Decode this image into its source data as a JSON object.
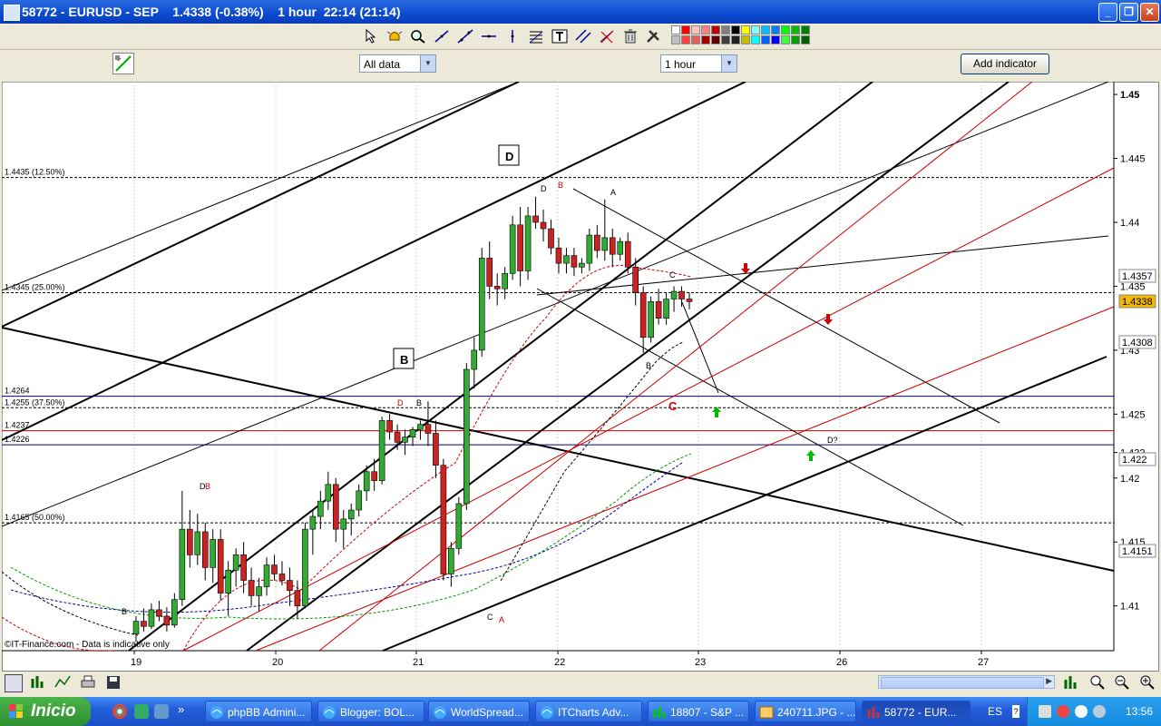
{
  "window": {
    "title": "58772 - EURUSD - SEP    1.4338 (-0.38%)    1 hour  22:14 (21:14)",
    "min": "_",
    "max": "❐",
    "close": "✕"
  },
  "toolbar": {
    "tools": [
      "cursor-icon",
      "alarm-icon",
      "zoom-icon",
      "line-icon",
      "trendline-icon",
      "horizontal-line-icon",
      "vertical-line-icon",
      "fibonacci-icon",
      "text-icon",
      "parallel-lines-icon",
      "delete-line-icon",
      "trash-icon",
      "tools-icon"
    ],
    "palette": [
      "#ffffff",
      "#ff0000",
      "#ffc0c0",
      "#ff8080",
      "#c00000",
      "#808080",
      "#000000",
      "#ffff00",
      "#80ffff",
      "#00c0ff",
      "#0080ff",
      "#00ff00",
      "#00c000",
      "#008000",
      "#c0c0c0",
      "#ff4040",
      "#e06060",
      "#a00000",
      "#600000",
      "#404040",
      "#202020",
      "#c0c000",
      "#00ffff",
      "#0060ff",
      "#0000ff",
      "#40ff40",
      "#00a000",
      "#006000"
    ]
  },
  "controls": {
    "range_select": "All data",
    "interval_select": "1 hour",
    "add_indicator": "Add indicator"
  },
  "chart_data": {
    "type": "candlestick",
    "symbol": "EURUSD",
    "interval": "1 hour",
    "ylim": [
      1.4065,
      1.451
    ],
    "y_ticks": [
      "1.45",
      "1.445",
      "1.44",
      "1.435",
      "1.43",
      "1.425",
      "1.422",
      "1.42",
      "1.415",
      "1.41"
    ],
    "x_ticks": [
      "19",
      "20",
      "21",
      "22",
      "23",
      "26",
      "27"
    ],
    "watermark": "©IT-Finance.com - Data is indicative only",
    "price_tags": [
      {
        "value": "1.4357",
        "color": "#cc2020",
        "bg": "#ffffff"
      },
      {
        "value": "1.4338",
        "color": "#000000",
        "bg": "#f5b800"
      },
      {
        "value": "1.4308",
        "color": "#000000",
        "bg": "#ffffff"
      },
      {
        "value": "1.422",
        "color": "#000000",
        "bg": "#ffffff"
      },
      {
        "value": "1.4151",
        "color": "#008000",
        "bg": "#ffffff"
      }
    ],
    "horizontal_lines": [
      {
        "label": "1.4435 (12.50%)",
        "value": 1.4435,
        "style": "dashed",
        "color": "#000000"
      },
      {
        "label": "1.4345 (25.00%)",
        "value": 1.4345,
        "style": "dashed",
        "color": "#000000"
      },
      {
        "label": "1.4264",
        "value": 1.4264,
        "style": "solid",
        "color": "#000080"
      },
      {
        "label": "1.4255 (37.50%)",
        "value": 1.4255,
        "style": "dashed",
        "color": "#000000"
      },
      {
        "label": "1.4237",
        "value": 1.4237,
        "style": "solid",
        "color": "#cc0000"
      },
      {
        "label": "1.4226",
        "value": 1.4226,
        "style": "solid",
        "color": "#000080"
      },
      {
        "label": "1.4165 (50.00%)",
        "value": 1.4165,
        "style": "dashed",
        "color": "#000000"
      }
    ],
    "wave_labels": [
      {
        "text": "D",
        "boxed": true
      },
      {
        "text": "B",
        "boxed": true
      },
      {
        "text": "D",
        "color": "#000000"
      },
      {
        "text": "B",
        "color": "#cc0000"
      },
      {
        "text": "A",
        "color": "#000000"
      },
      {
        "text": "C",
        "color": "#000000"
      },
      {
        "text": "B",
        "color": "#000000"
      },
      {
        "text": "C",
        "color": "#cc0000"
      },
      {
        "text": "D?",
        "color": "#000000"
      },
      {
        "text": "D",
        "color": "#cc0000"
      },
      {
        "text": "B",
        "color": "#000000"
      },
      {
        "text": "D",
        "color": "#000000"
      },
      {
        "text": "B",
        "color": "#cc0000"
      },
      {
        "text": "B",
        "color": "#000000"
      },
      {
        "text": "C",
        "color": "#000000"
      },
      {
        "text": "A",
        "color": "#cc0000"
      }
    ],
    "candles": [
      {
        "o": 1.4078,
        "h": 1.4092,
        "l": 1.4072,
        "c": 1.4088
      },
      {
        "o": 1.4088,
        "h": 1.4098,
        "l": 1.408,
        "c": 1.4084
      },
      {
        "o": 1.4084,
        "h": 1.4102,
        "l": 1.4082,
        "c": 1.4097
      },
      {
        "o": 1.4097,
        "h": 1.4104,
        "l": 1.4088,
        "c": 1.4092
      },
      {
        "o": 1.4092,
        "h": 1.4099,
        "l": 1.408,
        "c": 1.4085
      },
      {
        "o": 1.4085,
        "h": 1.411,
        "l": 1.4083,
        "c": 1.4105
      },
      {
        "o": 1.4105,
        "h": 1.419,
        "l": 1.41,
        "c": 1.416
      },
      {
        "o": 1.416,
        "h": 1.4175,
        "l": 1.413,
        "c": 1.414
      },
      {
        "o": 1.414,
        "h": 1.4172,
        "l": 1.4132,
        "c": 1.4158
      },
      {
        "o": 1.4158,
        "h": 1.4165,
        "l": 1.412,
        "c": 1.413
      },
      {
        "o": 1.413,
        "h": 1.416,
        "l": 1.4118,
        "c": 1.4152
      },
      {
        "o": 1.4152,
        "h": 1.416,
        "l": 1.4104,
        "c": 1.411
      },
      {
        "o": 1.411,
        "h": 1.4135,
        "l": 1.4092,
        "c": 1.4128
      },
      {
        "o": 1.4128,
        "h": 1.4145,
        "l": 1.4115,
        "c": 1.414
      },
      {
        "o": 1.414,
        "h": 1.415,
        "l": 1.411,
        "c": 1.412
      },
      {
        "o": 1.412,
        "h": 1.413,
        "l": 1.41,
        "c": 1.4108
      },
      {
        "o": 1.4108,
        "h": 1.4122,
        "l": 1.4096,
        "c": 1.4115
      },
      {
        "o": 1.4115,
        "h": 1.4138,
        "l": 1.4108,
        "c": 1.4132
      },
      {
        "o": 1.4132,
        "h": 1.414,
        "l": 1.412,
        "c": 1.4125
      },
      {
        "o": 1.4125,
        "h": 1.4135,
        "l": 1.4116,
        "c": 1.412
      },
      {
        "o": 1.412,
        "h": 1.413,
        "l": 1.41,
        "c": 1.4112
      },
      {
        "o": 1.4112,
        "h": 1.412,
        "l": 1.409,
        "c": 1.41
      },
      {
        "o": 1.41,
        "h": 1.4165,
        "l": 1.4098,
        "c": 1.416
      },
      {
        "o": 1.416,
        "h": 1.4175,
        "l": 1.414,
        "c": 1.417
      },
      {
        "o": 1.417,
        "h": 1.419,
        "l": 1.416,
        "c": 1.4182
      },
      {
        "o": 1.4182,
        "h": 1.4205,
        "l": 1.4175,
        "c": 1.4195
      },
      {
        "o": 1.4195,
        "h": 1.42,
        "l": 1.415,
        "c": 1.416
      },
      {
        "o": 1.416,
        "h": 1.4175,
        "l": 1.4145,
        "c": 1.4168
      },
      {
        "o": 1.4168,
        "h": 1.418,
        "l": 1.4155,
        "c": 1.4175
      },
      {
        "o": 1.4175,
        "h": 1.4195,
        "l": 1.417,
        "c": 1.419
      },
      {
        "o": 1.419,
        "h": 1.421,
        "l": 1.4182,
        "c": 1.4205
      },
      {
        "o": 1.4205,
        "h": 1.4215,
        "l": 1.419,
        "c": 1.4198
      },
      {
        "o": 1.4198,
        "h": 1.4248,
        "l": 1.4195,
        "c": 1.4245
      },
      {
        "o": 1.4245,
        "h": 1.425,
        "l": 1.423,
        "c": 1.4236
      },
      {
        "o": 1.4236,
        "h": 1.4242,
        "l": 1.4222,
        "c": 1.4228
      },
      {
        "o": 1.4228,
        "h": 1.4238,
        "l": 1.4218,
        "c": 1.4232
      },
      {
        "o": 1.4232,
        "h": 1.424,
        "l": 1.4225,
        "c": 1.4238
      },
      {
        "o": 1.4238,
        "h": 1.4245,
        "l": 1.423,
        "c": 1.4242
      },
      {
        "o": 1.4242,
        "h": 1.426,
        "l": 1.4225,
        "c": 1.4235
      },
      {
        "o": 1.4235,
        "h": 1.4245,
        "l": 1.42,
        "c": 1.421
      },
      {
        "o": 1.421,
        "h": 1.4215,
        "l": 1.412,
        "c": 1.4125
      },
      {
        "o": 1.4125,
        "h": 1.415,
        "l": 1.4115,
        "c": 1.4145
      },
      {
        "o": 1.4145,
        "h": 1.4185,
        "l": 1.414,
        "c": 1.418
      },
      {
        "o": 1.418,
        "h": 1.429,
        "l": 1.4175,
        "c": 1.4285
      },
      {
        "o": 1.4285,
        "h": 1.431,
        "l": 1.427,
        "c": 1.43
      },
      {
        "o": 1.43,
        "h": 1.438,
        "l": 1.4295,
        "c": 1.4372
      },
      {
        "o": 1.4372,
        "h": 1.4385,
        "l": 1.434,
        "c": 1.435
      },
      {
        "o": 1.435,
        "h": 1.436,
        "l": 1.4335,
        "c": 1.4348
      },
      {
        "o": 1.4348,
        "h": 1.4365,
        "l": 1.434,
        "c": 1.436
      },
      {
        "o": 1.436,
        "h": 1.4405,
        "l": 1.4355,
        "c": 1.4398
      },
      {
        "o": 1.4398,
        "h": 1.4412,
        "l": 1.435,
        "c": 1.4362
      },
      {
        "o": 1.4362,
        "h": 1.4412,
        "l": 1.4355,
        "c": 1.4405
      },
      {
        "o": 1.4405,
        "h": 1.442,
        "l": 1.4395,
        "c": 1.44
      },
      {
        "o": 1.44,
        "h": 1.441,
        "l": 1.4385,
        "c": 1.4395
      },
      {
        "o": 1.4395,
        "h": 1.4402,
        "l": 1.4375,
        "c": 1.438
      },
      {
        "o": 1.438,
        "h": 1.4388,
        "l": 1.436,
        "c": 1.4368
      },
      {
        "o": 1.4368,
        "h": 1.438,
        "l": 1.436,
        "c": 1.4374
      },
      {
        "o": 1.4374,
        "h": 1.438,
        "l": 1.4358,
        "c": 1.4365
      },
      {
        "o": 1.4365,
        "h": 1.4372,
        "l": 1.436,
        "c": 1.4368
      },
      {
        "o": 1.4368,
        "h": 1.4395,
        "l": 1.4362,
        "c": 1.439
      },
      {
        "o": 1.439,
        "h": 1.4398,
        "l": 1.4372,
        "c": 1.4378
      },
      {
        "o": 1.4378,
        "h": 1.4418,
        "l": 1.437,
        "c": 1.4388
      },
      {
        "o": 1.4388,
        "h": 1.4395,
        "l": 1.4365,
        "c": 1.4375
      },
      {
        "o": 1.4375,
        "h": 1.4388,
        "l": 1.437,
        "c": 1.4385
      },
      {
        "o": 1.4385,
        "h": 1.4392,
        "l": 1.436,
        "c": 1.4365
      },
      {
        "o": 1.4365,
        "h": 1.4372,
        "l": 1.4335,
        "c": 1.4345
      },
      {
        "o": 1.4345,
        "h": 1.435,
        "l": 1.4298,
        "c": 1.431
      },
      {
        "o": 1.431,
        "h": 1.4342,
        "l": 1.4306,
        "c": 1.4338
      },
      {
        "o": 1.4338,
        "h": 1.4348,
        "l": 1.432,
        "c": 1.4325
      },
      {
        "o": 1.4325,
        "h": 1.4345,
        "l": 1.432,
        "c": 1.434
      },
      {
        "o": 1.434,
        "h": 1.435,
        "l": 1.433,
        "c": 1.4346
      },
      {
        "o": 1.4346,
        "h": 1.435,
        "l": 1.4334,
        "c": 1.434
      },
      {
        "o": 1.434,
        "h": 1.4345,
        "l": 1.4332,
        "c": 1.4338
      }
    ]
  },
  "bottom_tools": [
    "chart-properties-icon",
    "compare-icon",
    "indicators-icon",
    "print-icon",
    "save-icon"
  ],
  "zoom_tools": [
    "chart-scroll-icon",
    "zoom-fit-icon",
    "zoom-out-icon",
    "zoom-in-icon"
  ],
  "taskbar": {
    "start": "Inicio",
    "tasks": [
      "phpBB Admini...",
      "Blogger: BOL...",
      "WorldSpread...",
      "ITCharts Adv...",
      "18807 - S&P ...",
      "240711.JPG - ...",
      "58772 - EUR..."
    ],
    "lang": "ES",
    "clock": "13:56"
  }
}
